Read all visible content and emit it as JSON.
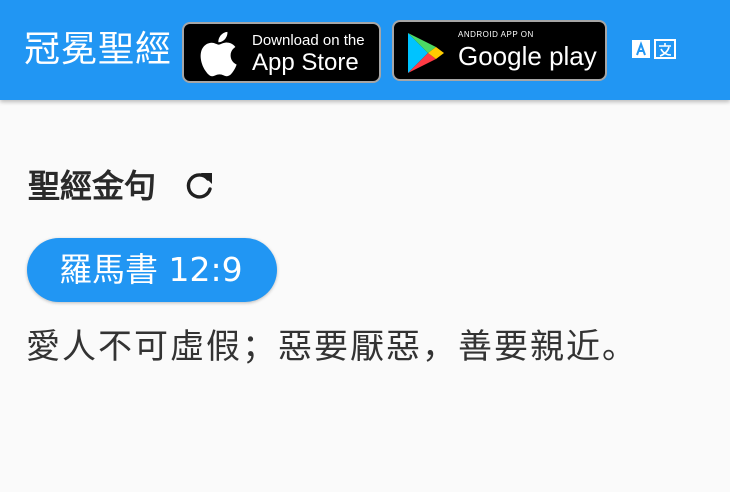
{
  "appbar": {
    "title": "冠冕聖經",
    "background_color": "#2196f3",
    "app_store": {
      "small_text": "Download on the",
      "big_text": "App Store",
      "icon": "apple-icon"
    },
    "google_play": {
      "small_text": "ANDROID APP ON",
      "big_text": "Google play",
      "icon": "google-play-icon"
    },
    "translate_icon": "translate-icon"
  },
  "main": {
    "section_title": "聖經金句",
    "refresh_icon": "refresh-icon",
    "verse": {
      "reference": "羅馬書 12:9",
      "text": "愛人不可虛假；惡要厭惡，善要親近。"
    }
  }
}
